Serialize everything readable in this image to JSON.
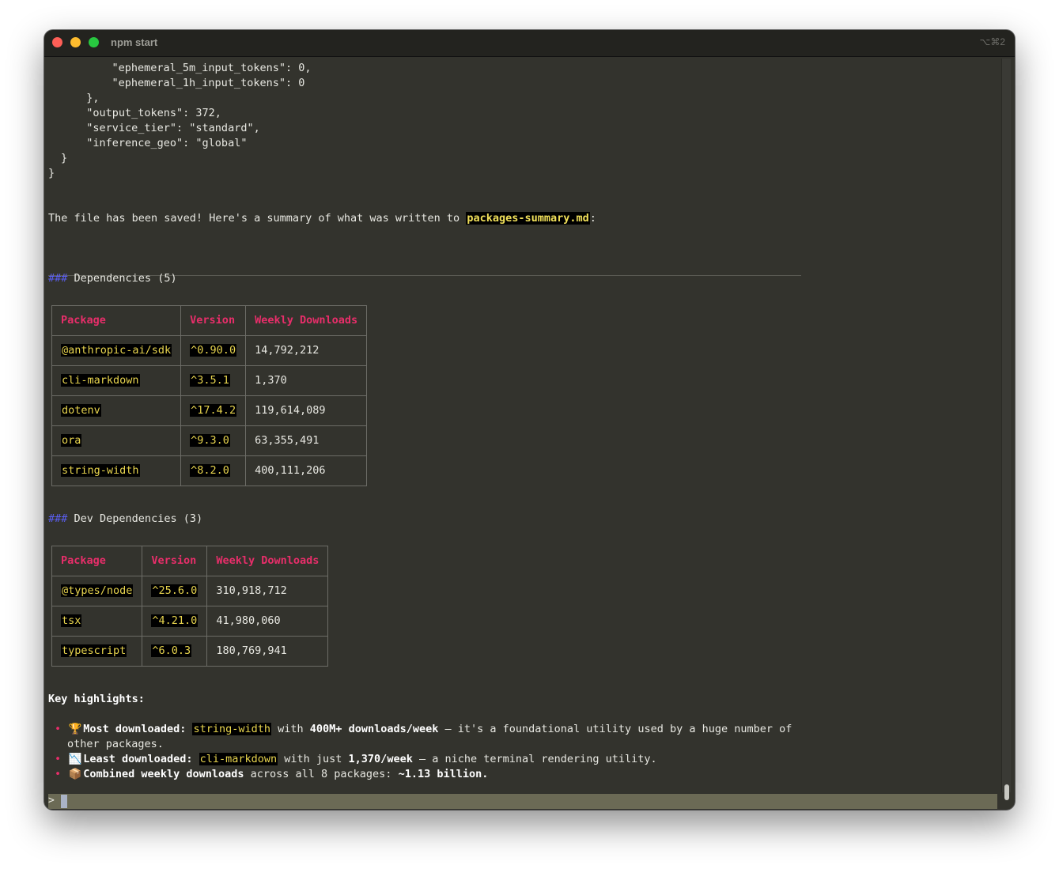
{
  "window": {
    "title": "npm start",
    "shortcut": "⌥⌘2"
  },
  "json_tail": [
    "    \"ephemeral_5m_input_tokens\": 0,",
    "    \"ephemeral_1h_input_tokens\": 0",
    "  },",
    "  \"output_tokens\": 372,",
    "  \"service_tier\": \"standard\",",
    "  \"inference_geo\": \"global\"",
    "}",
    "}"
  ],
  "summary": {
    "prefix": "The file has been saved! Here's a summary of what was written to ",
    "filename": "packages-summary.md",
    "suffix": ":"
  },
  "dependencies": {
    "heading_mark": "###",
    "heading": "Dependencies (5)",
    "columns": [
      "Package",
      "Version",
      "Weekly Downloads"
    ],
    "rows": [
      {
        "package": "@anthropic-ai/sdk",
        "version": "^0.90.0",
        "downloads": "14,792,212"
      },
      {
        "package": "cli-markdown",
        "version": "^3.5.1",
        "downloads": "1,370"
      },
      {
        "package": "dotenv",
        "version": "^17.4.2",
        "downloads": "119,614,089"
      },
      {
        "package": "ora",
        "version": "^9.3.0",
        "downloads": "63,355,491"
      },
      {
        "package": "string-width",
        "version": "^8.2.0",
        "downloads": "400,111,206"
      }
    ]
  },
  "dev_dependencies": {
    "heading_mark": "###",
    "heading": "Dev Dependencies (3)",
    "columns": [
      "Package",
      "Version",
      "Weekly Downloads"
    ],
    "rows": [
      {
        "package": "@types/node",
        "version": "^25.6.0",
        "downloads": "310,918,712"
      },
      {
        "package": "tsx",
        "version": "^4.21.0",
        "downloads": "41,980,060"
      },
      {
        "package": "typescript",
        "version": "^6.0.3",
        "downloads": "180,769,941"
      }
    ]
  },
  "highlights": {
    "title": "Key highlights:",
    "bullet": "•",
    "items": [
      {
        "emoji": "🏆",
        "label": "Most downloaded:",
        "code": "string-width",
        "mid": " with ",
        "strong": "400M+ downloads/week",
        "rest": " — it's a foundational utility used by a huge number of",
        "cont": "other packages."
      },
      {
        "emoji": "📉",
        "label": "Least downloaded:",
        "code": "cli-markdown",
        "mid": " with just ",
        "strong": "1,370/week",
        "rest": " — a niche terminal rendering utility."
      },
      {
        "emoji": "📦",
        "label": "Combined weekly downloads",
        "mid": " across all 8 packages: ",
        "strong": "~1.13 billion."
      }
    ]
  },
  "prompt": {
    "char": ">"
  }
}
